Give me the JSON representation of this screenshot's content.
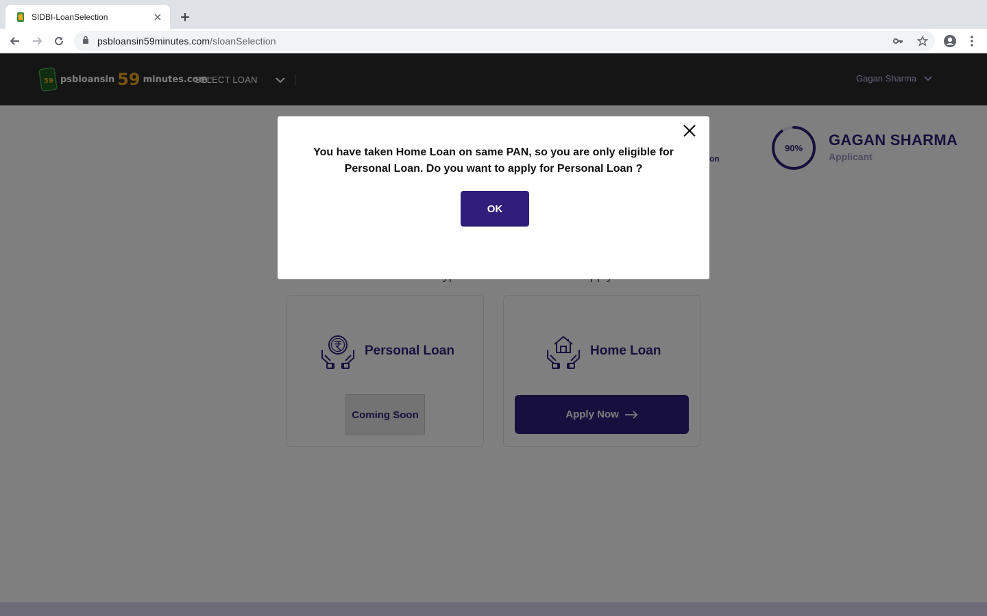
{
  "browser": {
    "tab_title": "SIDBI-LoanSelection",
    "url_domain": "psbloansin59minutes.com",
    "url_path": "/sloanSelection"
  },
  "header": {
    "logo_prefix": "psbloansin",
    "logo_number": "59",
    "logo_suffix": "minutes.com",
    "logo_tm": "™",
    "logo_badge_text": "59",
    "section_label": "SELECT LOAN",
    "user_name": "Gagan Sharma"
  },
  "profile": {
    "progress_percent": 90,
    "progress_label": "90%",
    "name": "GAGAN SHARMA",
    "role": "Applicant",
    "hint_fragment": "on"
  },
  "main": {
    "choose_title": "Choose Which Type of Loan You Want To Apply For",
    "cards": [
      {
        "label": "Personal Loan",
        "action": "Coming Soon"
      },
      {
        "label": "Home Loan",
        "action": "Apply Now"
      }
    ]
  },
  "modal": {
    "message": "You have taken Home Loan on same PAN, so you are only eligible for Personal Loan. Do you want to apply for Personal Loan ?",
    "ok_label": "OK"
  },
  "colors": {
    "brand_purple": "#2f1e7a",
    "header_bg": "#2a2b2d",
    "logo_orange": "#f5a623"
  }
}
